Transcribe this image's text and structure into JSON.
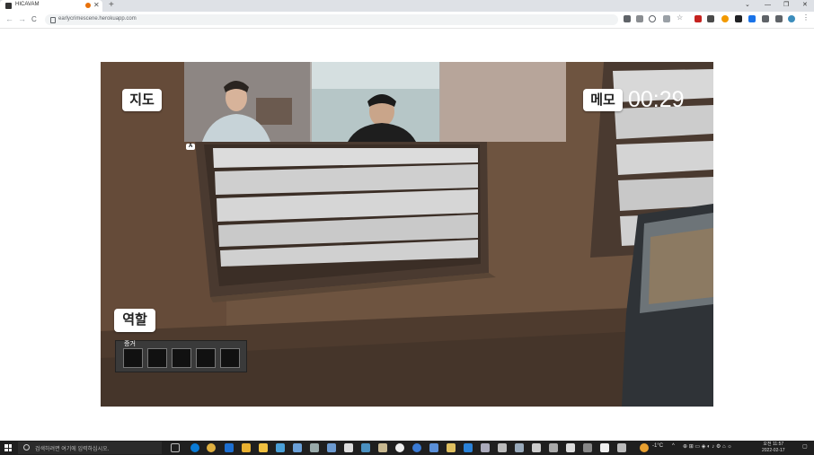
{
  "browser": {
    "tab_title": "HICAVAM",
    "new_tab": "+",
    "close": "✕",
    "url": "earlycrimescene.herokuapp.com",
    "window_min": "—",
    "window_restore": "❐",
    "window_close": "✕",
    "back": "←",
    "forward": "→",
    "reload": "C"
  },
  "game": {
    "map_button": "지도",
    "memo_button": "메모",
    "timer": "00:29",
    "role_button": "역할",
    "camera_label": "A",
    "inventory_label": "증거",
    "inventory_slots": 5
  },
  "taskbar": {
    "search_placeholder": "검색하려면 여기에 입력하십시오.",
    "weather": "-1°C",
    "time": "오전 11:57",
    "date": "2022-02-17"
  },
  "colors": {
    "tab_strip": "#dee1e6",
    "wall": "#6e5440",
    "taskbar": "#1f1f1f",
    "button_bg": "#ffffff"
  }
}
